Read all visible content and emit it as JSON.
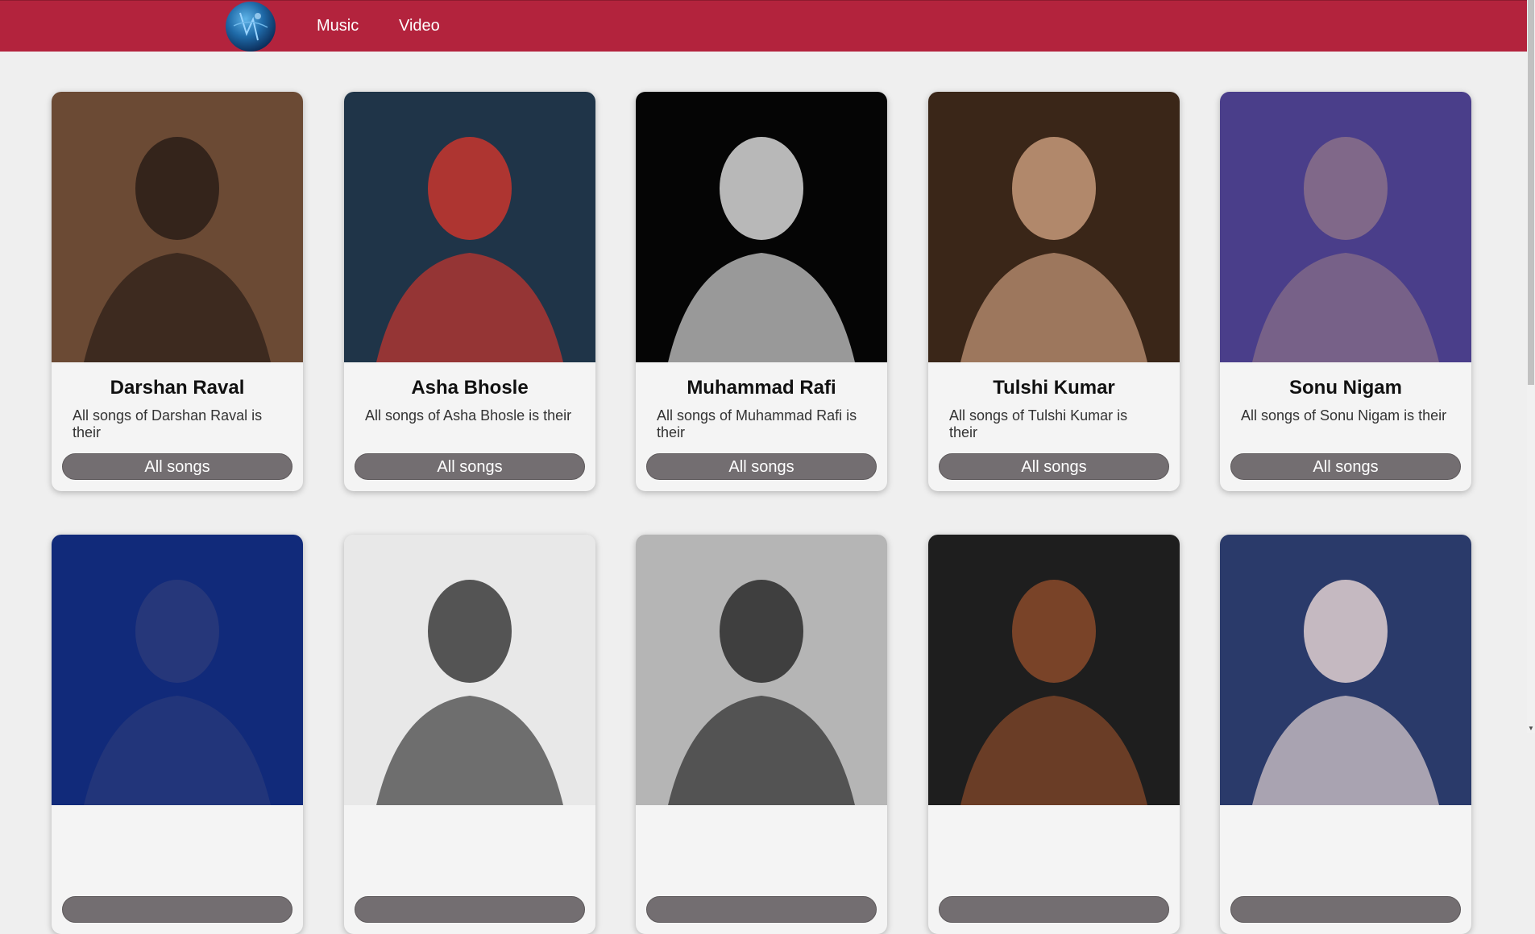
{
  "nav": {
    "links": [
      "Music",
      "Video"
    ]
  },
  "colors": {
    "navbar": "#b3233d",
    "background": "#efefef",
    "button": "#736e71"
  },
  "artists": [
    {
      "name": "Darshan Raval",
      "desc": "All songs of Darshan Raval is their",
      "button": "All songs",
      "bg": "#6b4a34",
      "fg": "#2a1d17"
    },
    {
      "name": "Asha Bhosle",
      "desc": "All songs of Asha Bhosle is their",
      "button": "All songs",
      "bg": "#1f3448",
      "fg": "#c8362e"
    },
    {
      "name": "Muhammad Rafi",
      "desc": "All songs of Muhammad Rafi is their",
      "button": "All songs",
      "bg": "#050505",
      "fg": "#d8d8d8"
    },
    {
      "name": "Tulshi Kumar",
      "desc": "All songs of Tulshi Kumar is their",
      "button": "All songs",
      "bg": "#3a2618",
      "fg": "#c79a7a"
    },
    {
      "name": "Sonu Nigam",
      "desc": "All songs of Sonu Nigam is their",
      "button": "All songs",
      "bg": "#4a3e8a",
      "fg": "#8a7088"
    },
    {
      "name": "",
      "desc": "",
      "button": "",
      "bg": "#112a7a",
      "fg": "#2a3a7a"
    },
    {
      "name": "",
      "desc": "",
      "button": "",
      "bg": "#e8e8e8",
      "fg": "#3a3a3a"
    },
    {
      "name": "",
      "desc": "",
      "button": "",
      "bg": "#b5b5b5",
      "fg": "#2a2a2a"
    },
    {
      "name": "",
      "desc": "",
      "button": "",
      "bg": "#1e1e1e",
      "fg": "#8a4a2a"
    },
    {
      "name": "",
      "desc": "",
      "button": "",
      "bg": "#2a3a6a",
      "fg": "#e0d0d0"
    }
  ]
}
